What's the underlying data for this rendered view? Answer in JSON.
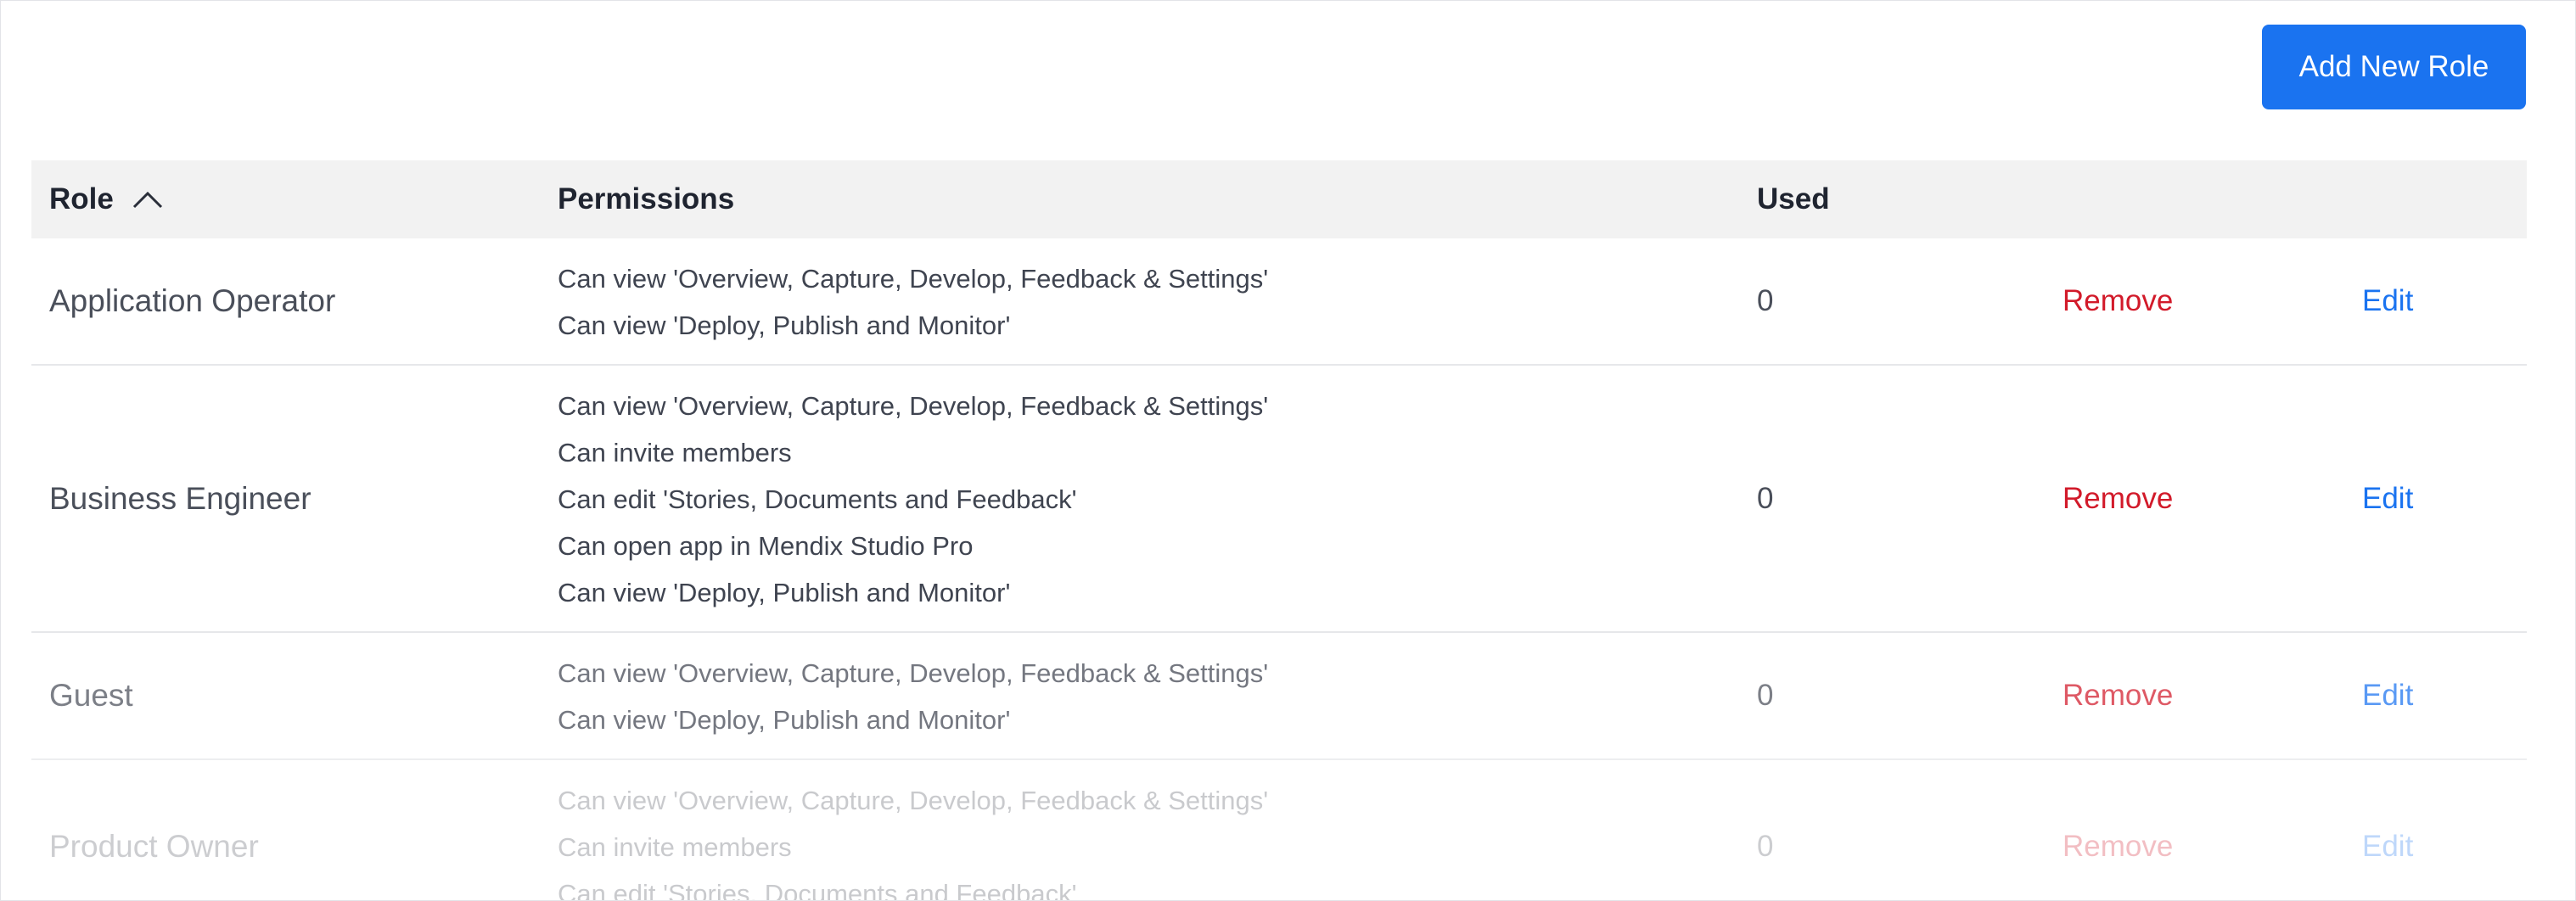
{
  "toolbar": {
    "add_role_label": "Add New Role"
  },
  "table": {
    "headers": {
      "role": "Role",
      "permissions": "Permissions",
      "used": "Used"
    },
    "sort": {
      "column": "Role",
      "direction": "ascending"
    },
    "rows": [
      {
        "role": "Application Operator",
        "permissions": [
          "Can view 'Overview, Capture, Develop, Feedback & Settings'",
          "Can view 'Deploy, Publish and Monitor'"
        ],
        "used": "0",
        "remove": "Remove",
        "edit": "Edit"
      },
      {
        "role": "Business Engineer",
        "permissions": [
          "Can view 'Overview, Capture, Develop, Feedback & Settings'",
          "Can invite members",
          "Can edit 'Stories, Documents and Feedback'",
          "Can open app in Mendix Studio Pro",
          "Can view 'Deploy, Publish and Monitor'"
        ],
        "used": "0",
        "remove": "Remove",
        "edit": "Edit"
      },
      {
        "role": "Guest",
        "permissions": [
          "Can view 'Overview, Capture, Develop, Feedback & Settings'",
          "Can view 'Deploy, Publish and Monitor'"
        ],
        "used": "0",
        "remove": "Remove",
        "edit": "Edit"
      },
      {
        "role": "Product Owner",
        "permissions": [
          "Can view 'Overview, Capture, Develop, Feedback & Settings'",
          "Can invite members",
          "Can edit 'Stories, Documents and Feedback'"
        ],
        "used": "0",
        "remove": "Remove",
        "edit": "Edit"
      }
    ]
  },
  "colors": {
    "primary": "#1a73f0",
    "danger": "#d21a2a",
    "header_bg": "#f2f2f2"
  }
}
